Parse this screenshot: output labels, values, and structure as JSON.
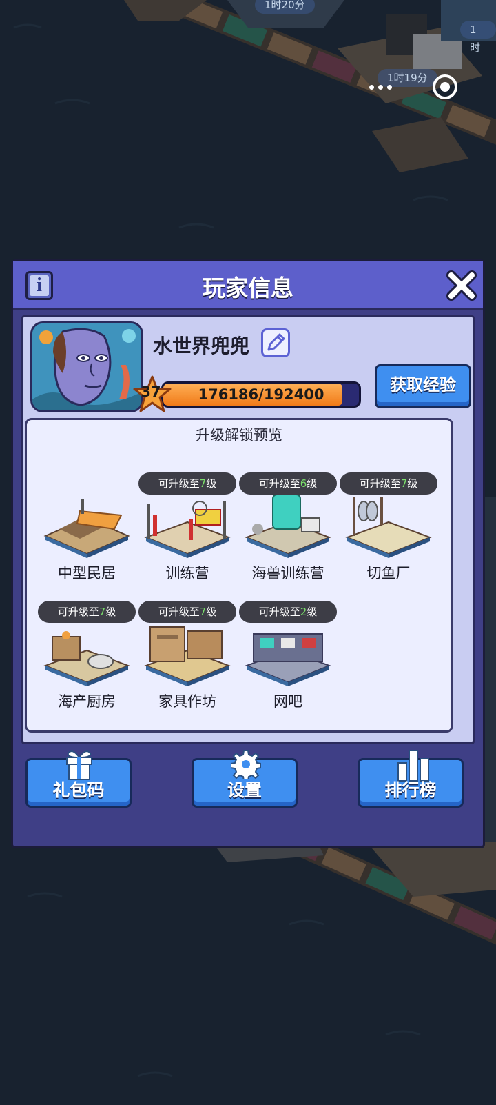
{
  "background": {
    "timers": [
      "1时20分",
      "1时19分",
      "1时"
    ]
  },
  "capsule": {
    "more_icon": "more-dots-icon",
    "close_icon": "target-icon"
  },
  "panel": {
    "title": "玩家信息",
    "player": {
      "name": "水世界兜兜",
      "level": "37",
      "exp_text": "176186/192400",
      "exp_fraction": 0.9157,
      "get_exp_label": "获取经验"
    },
    "preview": {
      "title": "升级解锁预览",
      "buildings": [
        {
          "name": "中型民居",
          "tag_prefix": "",
          "tag_level": "",
          "tag_suffix": ""
        },
        {
          "name": "训练营",
          "tag_prefix": "可升级至",
          "tag_level": "7",
          "tag_suffix": "级"
        },
        {
          "name": "海兽训练营",
          "tag_prefix": "可升级至",
          "tag_level": "6",
          "tag_suffix": "级"
        },
        {
          "name": "切鱼厂",
          "tag_prefix": "可升级至",
          "tag_level": "7",
          "tag_suffix": "级"
        },
        {
          "name": "海产厨房",
          "tag_prefix": "可升级至",
          "tag_level": "7",
          "tag_suffix": "级"
        },
        {
          "name": "家具作坊",
          "tag_prefix": "可升级至",
          "tag_level": "7",
          "tag_suffix": "级"
        },
        {
          "name": "网吧",
          "tag_prefix": "可升级至",
          "tag_level": "2",
          "tag_suffix": "级"
        }
      ]
    },
    "buttons": {
      "gift": "礼包码",
      "settings": "设置",
      "ranking": "排行榜"
    }
  },
  "colors": {
    "panel": "#3f3f86",
    "header": "#5d5fcb",
    "body": "#c9cdf2",
    "button": "#3f8ff0",
    "exp_fill": "#f07a18",
    "level_tag": "#7be06b"
  }
}
